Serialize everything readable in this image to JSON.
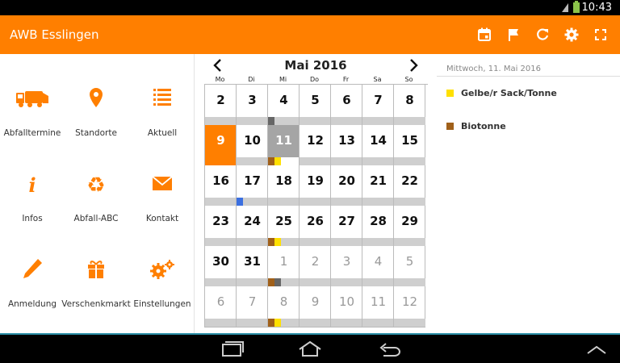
{
  "status": {
    "time": "10:43"
  },
  "app": {
    "title": "AWB Esslingen"
  },
  "actions": [
    {
      "name": "calendar-today-icon"
    },
    {
      "name": "flag-icon"
    },
    {
      "name": "refresh-icon"
    },
    {
      "name": "gear-icon"
    },
    {
      "name": "fullscreen-icon"
    }
  ],
  "menu": {
    "items": [
      {
        "label": "Abfalltermine",
        "icon": "truck-icon"
      },
      {
        "label": "Standorte",
        "icon": "location-pin-icon"
      },
      {
        "label": "Aktuell",
        "icon": "list-icon"
      },
      {
        "label": "Infos",
        "icon": "info-icon"
      },
      {
        "label": "Abfall-ABC",
        "icon": "recycle-icon"
      },
      {
        "label": "Kontakt",
        "icon": "envelope-icon"
      },
      {
        "label": "Anmeldung",
        "icon": "pencil-icon"
      },
      {
        "label": "Verschenkmarkt",
        "icon": "gift-icon"
      },
      {
        "label": "Einstellungen",
        "icon": "gears-icon"
      }
    ]
  },
  "calendar": {
    "title": "Mai 2016",
    "weekdays": [
      "Mo",
      "Di",
      "Mi",
      "Do",
      "Fr",
      "Sa",
      "So"
    ],
    "weeks": [
      [
        {
          "d": "2"
        },
        {
          "d": "3"
        },
        {
          "d": "4",
          "m": [
            "dgray"
          ]
        },
        {
          "d": "5"
        },
        {
          "d": "6"
        },
        {
          "d": "7"
        },
        {
          "d": "8"
        }
      ],
      [
        {
          "d": "9",
          "today": true
        },
        {
          "d": "10"
        },
        {
          "d": "11",
          "sel": true,
          "m": [
            "brown",
            "yellow"
          ]
        },
        {
          "d": "12"
        },
        {
          "d": "13"
        },
        {
          "d": "14"
        },
        {
          "d": "15"
        }
      ],
      [
        {
          "d": "16"
        },
        {
          "d": "17",
          "m": [
            "blue"
          ]
        },
        {
          "d": "18"
        },
        {
          "d": "19"
        },
        {
          "d": "20"
        },
        {
          "d": "21"
        },
        {
          "d": "22"
        }
      ],
      [
        {
          "d": "23"
        },
        {
          "d": "24"
        },
        {
          "d": "25",
          "m": [
            "brown",
            "yellow"
          ]
        },
        {
          "d": "26"
        },
        {
          "d": "27"
        },
        {
          "d": "28"
        },
        {
          "d": "29"
        }
      ],
      [
        {
          "d": "30"
        },
        {
          "d": "31"
        },
        {
          "d": "1",
          "o": true,
          "m": [
            "brown",
            "dgray"
          ]
        },
        {
          "d": "2",
          "o": true
        },
        {
          "d": "3",
          "o": true
        },
        {
          "d": "4",
          "o": true
        },
        {
          "d": "5",
          "o": true
        }
      ],
      [
        {
          "d": "6",
          "o": true
        },
        {
          "d": "7",
          "o": true
        },
        {
          "d": "8",
          "o": true,
          "m": [
            "brown",
            "yellow"
          ]
        },
        {
          "d": "9",
          "o": true
        },
        {
          "d": "10",
          "o": true
        },
        {
          "d": "11",
          "o": true
        },
        {
          "d": "12",
          "o": true
        }
      ]
    ]
  },
  "detail": {
    "date": "Mittwoch, 11. Mai 2016",
    "events": [
      {
        "label": "Gelbe/r Sack/Tonne",
        "color": "#ffe000"
      },
      {
        "label": "Biotonne",
        "color": "#a0601a"
      }
    ]
  },
  "colors": {
    "accent": "#ff7f00",
    "brown": "#a0601a",
    "yellow": "#ffe000",
    "blue": "#3b6fe0",
    "dgray": "#666666"
  }
}
